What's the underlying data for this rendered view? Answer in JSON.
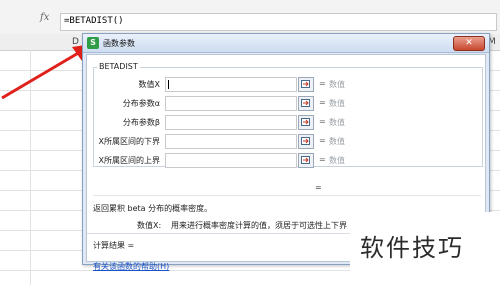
{
  "formula_bar": {
    "fx": "fx",
    "formula": "=BETADIST()"
  },
  "columns": {
    "left": "D",
    "right": "M"
  },
  "dialog": {
    "title": "函数参数",
    "app_icon": "S",
    "close_glyph": "✕",
    "function_name": "BETADIST",
    "args": [
      {
        "label": "数值X",
        "value": "数值"
      },
      {
        "label": "分布参数α",
        "value": "数值"
      },
      {
        "label": "分布参数β",
        "value": "数值"
      },
      {
        "label": "X所属区间的下界",
        "value": "数值"
      },
      {
        "label": "X所属区间的上界",
        "value": "数值"
      }
    ],
    "eq": "=",
    "result_eq": "=",
    "description": "返回累积 beta 分布的概率密度。",
    "param_name": "数值X:",
    "param_desc": "用来进行概率密度计算的值，须居于可选性上下界（A 和 B）之间",
    "calc_result": "计算结果 =",
    "help_link": "有关该函数的帮助(H)"
  },
  "watermark": "软件技巧",
  "colors": {
    "arrow": "#e0201b",
    "link": "#1a53c8",
    "icon_green": "#2e9d45",
    "close_red": "#c8472e"
  }
}
